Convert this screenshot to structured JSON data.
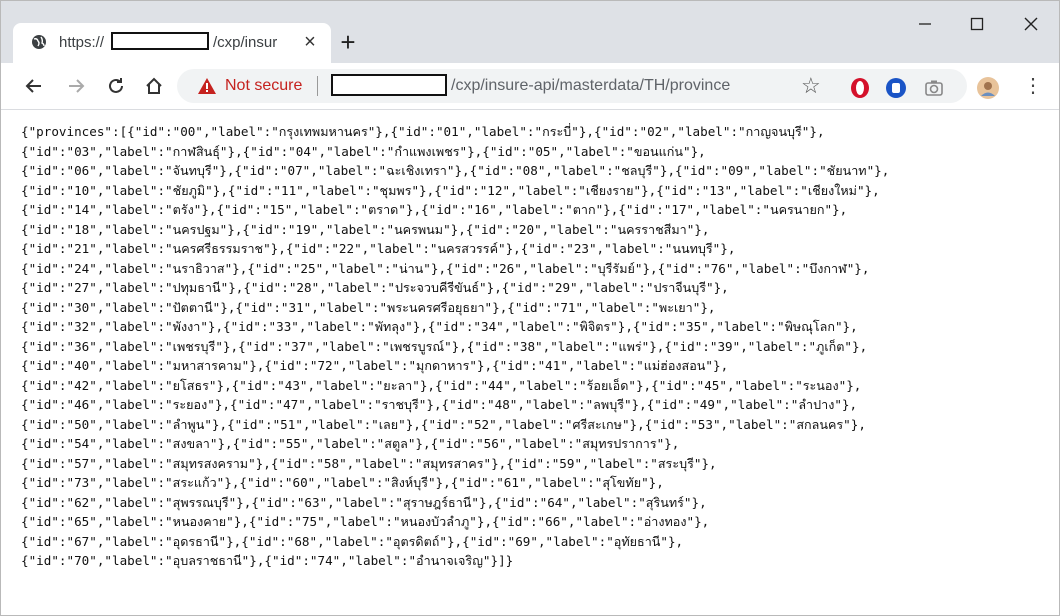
{
  "tab": {
    "title_prefix": "https://",
    "title_suffix": "/cxp/insur",
    "close_glyph": "×",
    "favicon": "globe-icon"
  },
  "new_tab_glyph": "+",
  "window_controls": {
    "minimize": "—",
    "maximize": "☐",
    "close": "✕"
  },
  "toolbar": {
    "back": "←",
    "forward": "→",
    "reload": "C",
    "home": "⌂",
    "security_label": "Not secure",
    "url_path": "/cxp/insure-api/masterdata/TH/province",
    "star_glyph": "☆",
    "menu_glyph": "⋮"
  },
  "content": {
    "lines": [
      "{\"provinces\":[{\"id\":\"00\",\"label\":\"กรุงเทพมหานคร\"},{\"id\":\"01\",\"label\":\"กระบี่\"},{\"id\":\"02\",\"label\":\"กาญจนบุรี\"},",
      "{\"id\":\"03\",\"label\":\"กาฬสินธุ์\"},{\"id\":\"04\",\"label\":\"กำแพงเพชร\"},{\"id\":\"05\",\"label\":\"ขอนแก่น\"},",
      "{\"id\":\"06\",\"label\":\"จันทบุรี\"},{\"id\":\"07\",\"label\":\"ฉะเชิงเทรา\"},{\"id\":\"08\",\"label\":\"ชลบุรี\"},{\"id\":\"09\",\"label\":\"ชัยนาท\"},",
      "{\"id\":\"10\",\"label\":\"ชัยภูมิ\"},{\"id\":\"11\",\"label\":\"ชุมพร\"},{\"id\":\"12\",\"label\":\"เชียงราย\"},{\"id\":\"13\",\"label\":\"เชียงใหม่\"},",
      "{\"id\":\"14\",\"label\":\"ตรัง\"},{\"id\":\"15\",\"label\":\"ตราด\"},{\"id\":\"16\",\"label\":\"ตาก\"},{\"id\":\"17\",\"label\":\"นครนายก\"},",
      "{\"id\":\"18\",\"label\":\"นครปฐม\"},{\"id\":\"19\",\"label\":\"นครพนม\"},{\"id\":\"20\",\"label\":\"นครราชสีมา\"},",
      "{\"id\":\"21\",\"label\":\"นครศรีธรรมราช\"},{\"id\":\"22\",\"label\":\"นครสวรรค์\"},{\"id\":\"23\",\"label\":\"นนทบุรี\"},",
      "{\"id\":\"24\",\"label\":\"นราธิวาส\"},{\"id\":\"25\",\"label\":\"น่าน\"},{\"id\":\"26\",\"label\":\"บุรีรัมย์\"},{\"id\":\"76\",\"label\":\"บึงกาฬ\"},",
      "{\"id\":\"27\",\"label\":\"ปทุมธานี\"},{\"id\":\"28\",\"label\":\"ประจวบคีรีขันธ์\"},{\"id\":\"29\",\"label\":\"ปราจีนบุรี\"},",
      "{\"id\":\"30\",\"label\":\"ปัตตานี\"},{\"id\":\"31\",\"label\":\"พระนครศรีอยุธยา\"},{\"id\":\"71\",\"label\":\"พะเยา\"},",
      "{\"id\":\"32\",\"label\":\"พังงา\"},{\"id\":\"33\",\"label\":\"พัทลุง\"},{\"id\":\"34\",\"label\":\"พิจิตร\"},{\"id\":\"35\",\"label\":\"พิษณุโลก\"},",
      "{\"id\":\"36\",\"label\":\"เพชรบุรี\"},{\"id\":\"37\",\"label\":\"เพชรบูรณ์\"},{\"id\":\"38\",\"label\":\"แพร่\"},{\"id\":\"39\",\"label\":\"ภูเก็ต\"},",
      "{\"id\":\"40\",\"label\":\"มหาสารคาม\"},{\"id\":\"72\",\"label\":\"มุกดาหาร\"},{\"id\":\"41\",\"label\":\"แม่ฮ่องสอน\"},",
      "{\"id\":\"42\",\"label\":\"ยโสธร\"},{\"id\":\"43\",\"label\":\"ยะลา\"},{\"id\":\"44\",\"label\":\"ร้อยเอ็ด\"},{\"id\":\"45\",\"label\":\"ระนอง\"},",
      "{\"id\":\"46\",\"label\":\"ระยอง\"},{\"id\":\"47\",\"label\":\"ราชบุรี\"},{\"id\":\"48\",\"label\":\"ลพบุรี\"},{\"id\":\"49\",\"label\":\"ลำปาง\"},",
      "{\"id\":\"50\",\"label\":\"ลำพูน\"},{\"id\":\"51\",\"label\":\"เลย\"},{\"id\":\"52\",\"label\":\"ศรีสะเกษ\"},{\"id\":\"53\",\"label\":\"สกลนคร\"},",
      "{\"id\":\"54\",\"label\":\"สงขลา\"},{\"id\":\"55\",\"label\":\"สตูล\"},{\"id\":\"56\",\"label\":\"สมุทรปราการ\"},",
      "{\"id\":\"57\",\"label\":\"สมุทรสงคราม\"},{\"id\":\"58\",\"label\":\"สมุทรสาคร\"},{\"id\":\"59\",\"label\":\"สระบุรี\"},",
      "{\"id\":\"73\",\"label\":\"สระแก้ว\"},{\"id\":\"60\",\"label\":\"สิงห์บุรี\"},{\"id\":\"61\",\"label\":\"สุโขทัย\"},",
      "{\"id\":\"62\",\"label\":\"สุพรรณบุรี\"},{\"id\":\"63\",\"label\":\"สุราษฎร์ธานี\"},{\"id\":\"64\",\"label\":\"สุรินทร์\"},",
      "{\"id\":\"65\",\"label\":\"หนองคาย\"},{\"id\":\"75\",\"label\":\"หนองบัวลำภู\"},{\"id\":\"66\",\"label\":\"อ่างทอง\"},",
      "{\"id\":\"67\",\"label\":\"อุดรธานี\"},{\"id\":\"68\",\"label\":\"อุตรดิตถ์\"},{\"id\":\"69\",\"label\":\"อุทัยธานี\"},",
      "{\"id\":\"70\",\"label\":\"อุบลราชธานี\"},{\"id\":\"74\",\"label\":\"อำนาจเจริญ\"}]}"
    ]
  },
  "colors": {
    "tabstrip": "#dee1e6",
    "omnibox": "#f1f3f4",
    "not_secure": "#c5221f",
    "opera_red": "#d4112b",
    "ext_blue": "#1a54c6"
  }
}
